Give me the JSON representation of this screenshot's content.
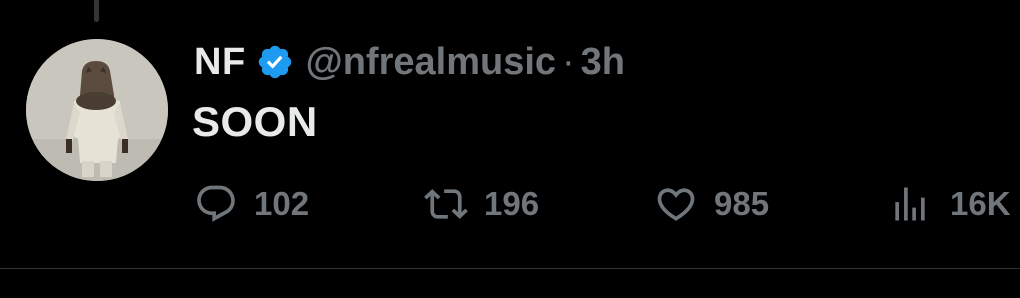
{
  "tweet": {
    "author": {
      "display_name": "NF",
      "handle": "@nfrealmusic",
      "verified": true,
      "verified_color": "#1d9bf0"
    },
    "separator": "·",
    "time": "3h",
    "text": "SOON"
  },
  "actions": {
    "reply": {
      "icon": "reply-icon",
      "count": "102"
    },
    "retweet": {
      "icon": "retweet-icon",
      "count": "196"
    },
    "like": {
      "icon": "heart-icon",
      "count": "985"
    },
    "views": {
      "icon": "views-icon",
      "count": "16K"
    }
  },
  "colors": {
    "background": "#000000",
    "primary_text": "#e7e9ea",
    "secondary_text": "#71767b",
    "divider": "#2f3336"
  }
}
